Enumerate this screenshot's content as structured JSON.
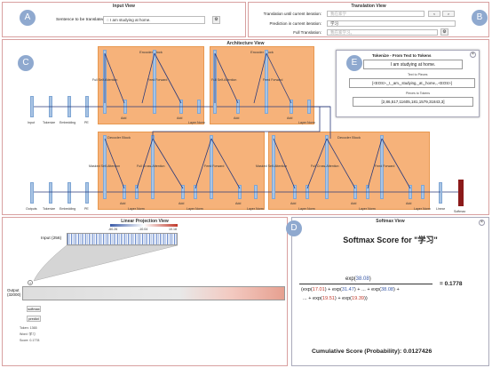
{
  "input_view": {
    "title": "Input View",
    "sentence_label": "Sentence to be translated:",
    "sentence_value": "I am studying at home."
  },
  "translation_view": {
    "title": "Translation View",
    "row1_label": "Translation until current iteration:",
    "row1_value": "我在家学",
    "row2_label": "Prediction in current iteration:",
    "row2_value": "学习",
    "row3_label": "Full Translation:",
    "row3_value": "我在家学习。",
    "prev": "<",
    "next": ">"
  },
  "architecture_view": {
    "title": "Architecture View",
    "encoder_block": "Encoder Block",
    "decoder_block": "Decoder Block",
    "enc_labels": [
      "Input",
      "Tokenize",
      "Embedding",
      "PE"
    ],
    "dec_labels": [
      "Outputs",
      "Tokenize",
      "Embedding",
      "PE"
    ],
    "out_labels": [
      "Linear",
      "Softmax"
    ],
    "enc_sub": [
      "Full Self-Attention",
      "Feed Forward",
      "Add",
      "Add",
      "Layer Norm",
      "Layer Norm"
    ],
    "dec_sub": [
      "Masked Self-Attention",
      "Full Cross-Attention",
      "Feed Forward",
      "Add",
      "Add",
      "Add",
      "Layer Norm",
      "Layer Norm",
      "Layer Norm"
    ]
  },
  "tokenize_popup": {
    "title": "Tokenize - From Text to Tokens",
    "text": "I am studying at home.",
    "pieces_label": "Text to Pieces",
    "pieces": "[<EOS>,_I,_am,_studying,_at,_home,.,<EOS>]",
    "tokens_label": "Pieces to Tokens",
    "tokens": "[2,86,517,11605,181,1579,31843,3]"
  },
  "linear_view": {
    "title": "Linear Projection View",
    "input_label": "Input (256)",
    "output_label": "Output (32000)",
    "scale": [
      "-60.26",
      "-10.04",
      "10.18"
    ],
    "softmax_btn": "softmax",
    "predict_btn": "predict",
    "token": "Token: 1365",
    "word": "Word: 学习",
    "score": "Score: 0.1778"
  },
  "softmax_view": {
    "title": "Softmax View",
    "heading": "Softmax Score for \"学习\"",
    "numerator": "exp(38.08)",
    "den1_pre": "(exp(",
    "den_a": "17.01",
    "den_b": "31.47",
    "den_c": "38.08",
    "den_d": "19.51",
    "den_e": "19.39",
    "result": "= 0.1778",
    "cumulative_label": "Cumulative Score (Probability):",
    "cumulative_value": "0.0127426"
  },
  "badges": [
    "A",
    "B",
    "C",
    "D",
    "E"
  ],
  "colors": {
    "accent": "#8fa9cf",
    "block": "#f6b27a",
    "border": "#d8a0a0"
  }
}
